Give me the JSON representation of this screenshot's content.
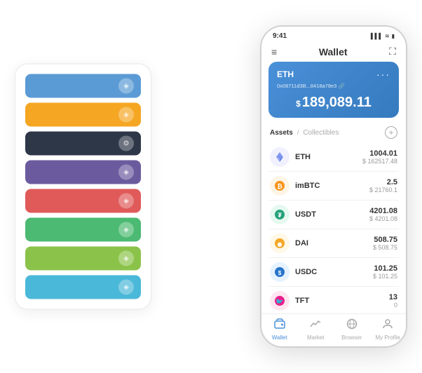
{
  "scene": {
    "leftPanel": {
      "cards": [
        {
          "color": "card-blue",
          "icon": "◈"
        },
        {
          "color": "card-orange",
          "icon": "◈"
        },
        {
          "color": "card-dark",
          "icon": "⚙"
        },
        {
          "color": "card-purple",
          "icon": "◈"
        },
        {
          "color": "card-red",
          "icon": "◈"
        },
        {
          "color": "card-green",
          "icon": "◈"
        },
        {
          "color": "card-light-green",
          "icon": "◈"
        },
        {
          "color": "card-sky",
          "icon": "◈"
        }
      ]
    },
    "phone": {
      "statusBar": {
        "time": "9:41",
        "signal": "▌▌▌",
        "wifi": "WiFi",
        "battery": "🔋"
      },
      "header": {
        "menuIcon": "≡",
        "title": "Wallet",
        "scanIcon": "⛶"
      },
      "ethCard": {
        "label": "ETH",
        "dots": "···",
        "address": "0x08711d3B...8418a78e3  🔗",
        "balancePrefix": "$",
        "balance": "189,089.11"
      },
      "assetsHeader": {
        "activeTab": "Assets",
        "divider": "/",
        "inactiveTab": "Collectibles",
        "addIcon": "+"
      },
      "assets": [
        {
          "symbol": "ETH",
          "name": "ETH",
          "iconEmoji": "♦",
          "iconBg": "icon-eth",
          "amount": "1004.01",
          "usdValue": "$ 162517.48"
        },
        {
          "symbol": "imBTC",
          "name": "imBTC",
          "iconEmoji": "₿",
          "iconBg": "icon-imbtc",
          "amount": "2.5",
          "usdValue": "$ 21760.1"
        },
        {
          "symbol": "USDT",
          "name": "USDT",
          "iconEmoji": "₮",
          "iconBg": "icon-usdt",
          "amount": "4201.08",
          "usdValue": "$ 4201.08"
        },
        {
          "symbol": "DAI",
          "name": "DAI",
          "iconEmoji": "◉",
          "iconBg": "icon-dai",
          "amount": "508.75",
          "usdValue": "$ 508.75"
        },
        {
          "symbol": "USDC",
          "name": "USDC",
          "iconEmoji": "◎",
          "iconBg": "icon-usdc",
          "amount": "101.25",
          "usdValue": "$ 101.25"
        },
        {
          "symbol": "TFT",
          "name": "TFT",
          "iconEmoji": "🐦",
          "iconBg": "icon-tft",
          "amount": "13",
          "usdValue": "0"
        }
      ],
      "bottomNav": [
        {
          "label": "Wallet",
          "icon": "◉",
          "active": true
        },
        {
          "label": "Market",
          "icon": "📈",
          "active": false
        },
        {
          "label": "Browser",
          "icon": "🌐",
          "active": false
        },
        {
          "label": "My Profile",
          "icon": "👤",
          "active": false
        }
      ]
    }
  }
}
